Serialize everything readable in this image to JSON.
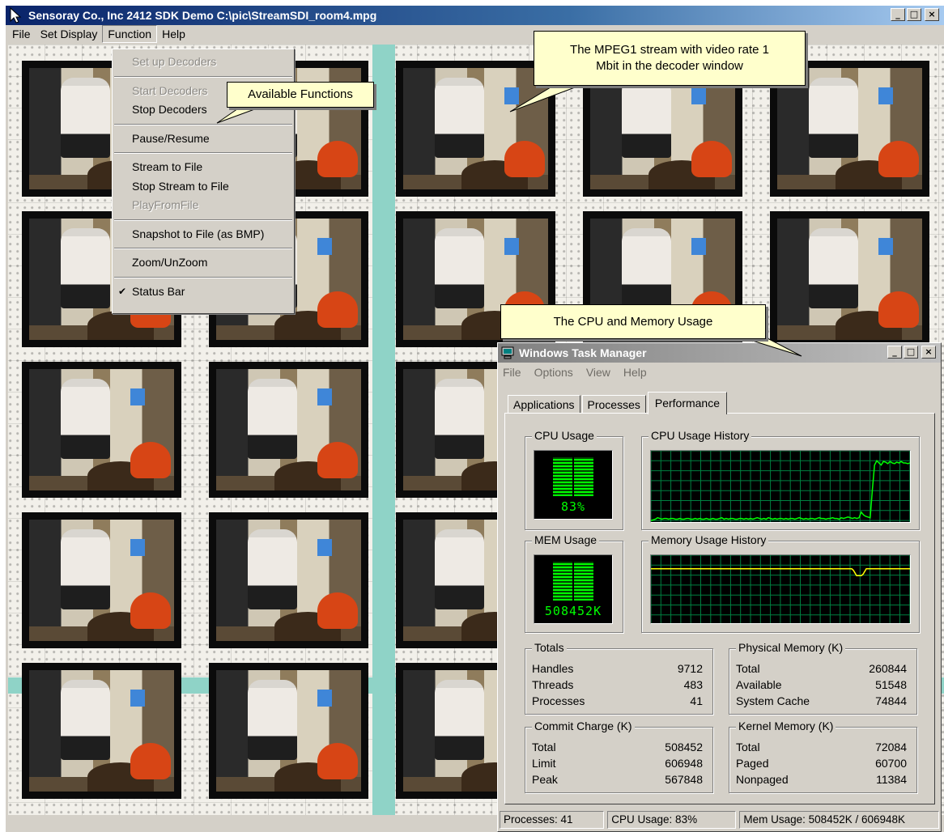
{
  "main_window": {
    "title": "Sensoray Co., Inc 2412 SDK Demo  C:\\pic\\StreamSDI_room4.mpg",
    "menu": [
      "File",
      "Set Display",
      "Function",
      "Help"
    ],
    "buttons": {
      "minimize": "_",
      "maximize": "□",
      "close": "×"
    }
  },
  "function_menu": {
    "items": [
      {
        "label": "Set up Decoders",
        "enabled": false
      },
      {
        "sep": true
      },
      {
        "label": "Start Decoders",
        "enabled": false
      },
      {
        "label": "Stop Decoders",
        "enabled": true
      },
      {
        "sep": true
      },
      {
        "label": "Pause/Resume",
        "enabled": true
      },
      {
        "sep": true
      },
      {
        "label": "Stream to File",
        "enabled": true
      },
      {
        "label": "Stop Stream to File",
        "enabled": true
      },
      {
        "label": "PlayFromFile",
        "enabled": false
      },
      {
        "sep": true
      },
      {
        "label": "Snapshot to File (as BMP)",
        "enabled": true
      },
      {
        "sep": true
      },
      {
        "label": "Zoom/UnZoom",
        "enabled": true
      },
      {
        "sep": true
      },
      {
        "label": "Status Bar",
        "enabled": true,
        "checked": true,
        "check": "✔"
      }
    ]
  },
  "callouts": {
    "functions": "Available Functions",
    "mpeg_line1": "The MPEG1 stream with video rate 1",
    "mpeg_line2": "Mbit in the decoder window",
    "cpu": "The  CPU and Memory Usage"
  },
  "task_manager": {
    "title": "Windows Task Manager",
    "menu": [
      "File",
      "Options",
      "View",
      "Help"
    ],
    "tabs": [
      "Applications",
      "Processes",
      "Performance"
    ],
    "active_tab": "Performance",
    "cpu_usage": {
      "label": "CPU Usage",
      "value": "83%"
    },
    "cpu_history": {
      "label": "CPU Usage History",
      "series": [
        0.02,
        0.03,
        0.04,
        0.06,
        0.05,
        0.04,
        0.05,
        0.05,
        0.04,
        0.05,
        0.05,
        0.04,
        0.04,
        0.05,
        0.04,
        0.04,
        0.05,
        0.05,
        0.04,
        0.04,
        0.05,
        0.04,
        0.05,
        0.04,
        0.04,
        0.05,
        0.04,
        0.04,
        0.05,
        0.04,
        0.04,
        0.05,
        0.06,
        0.04,
        0.05,
        0.04,
        0.05,
        0.05,
        0.04,
        0.04,
        0.05,
        0.05,
        0.04,
        0.05,
        0.04,
        0.05,
        0.04,
        0.05,
        0.06,
        0.05,
        0.04,
        0.05,
        0.04,
        0.06,
        0.05,
        0.04,
        0.05,
        0.04,
        0.05,
        0.05,
        0.04,
        0.05,
        0.04,
        0.05,
        0.05,
        0.04,
        0.05,
        0.06,
        0.05,
        0.04,
        0.05,
        0.04,
        0.05,
        0.05,
        0.04,
        0.05,
        0.06,
        0.05,
        0.05,
        0.04,
        0.05,
        0.05,
        0.06,
        0.05,
        0.05,
        0.04,
        0.06,
        0.05,
        0.06,
        0.07,
        0.06,
        0.05,
        0.06,
        0.05,
        0.06,
        0.14,
        0.1,
        0.08,
        0.07,
        0.06,
        0.45,
        0.8,
        0.86,
        0.83,
        0.8,
        0.85,
        0.84,
        0.82,
        0.85,
        0.83,
        0.82,
        0.84,
        0.83,
        0.85,
        0.83,
        0.83,
        0.82,
        0.83
      ]
    },
    "mem_usage": {
      "label": "MEM Usage",
      "value": "508452K"
    },
    "mem_history": {
      "label": "Memory Usage History",
      "series": [
        0.8,
        0.8,
        0.8,
        0.8,
        0.8,
        0.8,
        0.8,
        0.8,
        0.8,
        0.8,
        0.8,
        0.8,
        0.8,
        0.8,
        0.8,
        0.8,
        0.8,
        0.8,
        0.8,
        0.8,
        0.8,
        0.8,
        0.8,
        0.8,
        0.8,
        0.8,
        0.8,
        0.8,
        0.8,
        0.8,
        0.8,
        0.8,
        0.8,
        0.8,
        0.8,
        0.8,
        0.8,
        0.8,
        0.8,
        0.8,
        0.8,
        0.8,
        0.8,
        0.8,
        0.8,
        0.8,
        0.8,
        0.8,
        0.8,
        0.8,
        0.8,
        0.8,
        0.8,
        0.8,
        0.8,
        0.8,
        0.8,
        0.8,
        0.8,
        0.8,
        0.8,
        0.8,
        0.8,
        0.8,
        0.8,
        0.8,
        0.8,
        0.8,
        0.8,
        0.8,
        0.8,
        0.8,
        0.8,
        0.8,
        0.8,
        0.8,
        0.8,
        0.8,
        0.8,
        0.8,
        0.8,
        0.8,
        0.8,
        0.8,
        0.8,
        0.8,
        0.8,
        0.8,
        0.8,
        0.8,
        0.8,
        0.8,
        0.8,
        0.8,
        0.8,
        0.8,
        0.8,
        0.8,
        0.8,
        0.8,
        0.8,
        0.8,
        0.8,
        0.8,
        0.8,
        0.8,
        0.8,
        0.8,
        0.8,
        0.8,
        0.8,
        0.8,
        0.8,
        0.8,
        0.8,
        0.8,
        0.8,
        0.8,
        0.8,
        0.8,
        0.8,
        0.8,
        0.8,
        0.8,
        0.8,
        0.78,
        0.74,
        0.7,
        0.7,
        0.7,
        0.7,
        0.72,
        0.76,
        0.8,
        0.8,
        0.8,
        0.8,
        0.8,
        0.8,
        0.8,
        0.8,
        0.8,
        0.8,
        0.8,
        0.8,
        0.8,
        0.8,
        0.8,
        0.8,
        0.8,
        0.8,
        0.8,
        0.8,
        0.8,
        0.8,
        0.8,
        0.8,
        0.8,
        0.8,
        0.8,
        0.8
      ]
    },
    "totals": {
      "label": "Totals",
      "rows": [
        [
          "Handles",
          "9712"
        ],
        [
          "Threads",
          "483"
        ],
        [
          "Processes",
          "41"
        ]
      ]
    },
    "physical_memory": {
      "label": "Physical Memory (K)",
      "rows": [
        [
          "Total",
          "260844"
        ],
        [
          "Available",
          "51548"
        ],
        [
          "System Cache",
          "74844"
        ]
      ]
    },
    "commit_charge": {
      "label": "Commit Charge (K)",
      "rows": [
        [
          "Total",
          "508452"
        ],
        [
          "Limit",
          "606948"
        ],
        [
          "Peak",
          "567848"
        ]
      ]
    },
    "kernel_memory": {
      "label": "Kernel Memory (K)",
      "rows": [
        [
          "Total",
          "72084"
        ],
        [
          "Paged",
          "60700"
        ],
        [
          "Nonpaged",
          "11384"
        ]
      ]
    },
    "status": {
      "processes": "Processes: 41",
      "cpu": "CPU Usage: 83%",
      "mem": "Mem Usage: 508452K / 606948K"
    },
    "buttons": {
      "minimize": "_",
      "maximize": "□",
      "close": "×"
    }
  }
}
